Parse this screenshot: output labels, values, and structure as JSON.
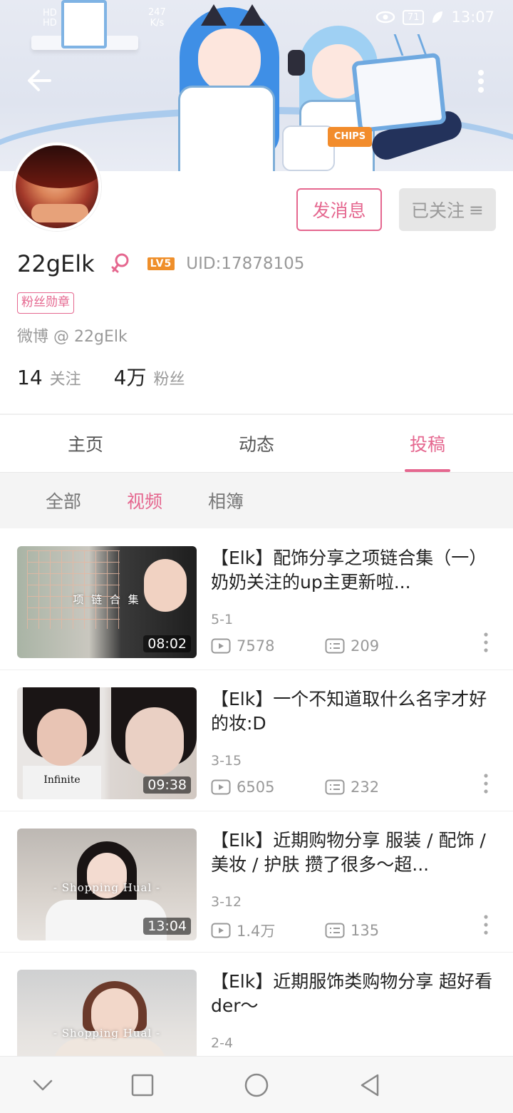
{
  "status": {
    "left_top": "HD",
    "left_bottom": "HD",
    "net_speed": "247",
    "net_unit": "K/s",
    "battery": "71",
    "time": "13:07"
  },
  "banner": {
    "chips_label": "CHIPS"
  },
  "profile": {
    "name": "22gElk",
    "level_badge": "LV5",
    "uid": "UID:17878105",
    "medal": "粉丝勋章",
    "weibo": "微博 @ 22gElk",
    "following_count": "14",
    "following_label": "关注",
    "fans_count": "4万",
    "fans_label": "粉丝"
  },
  "actions": {
    "message": "发消息",
    "followed": "已关注",
    "followed_icon": "≡"
  },
  "tabs": [
    {
      "label": "主页"
    },
    {
      "label": "动态"
    },
    {
      "label": "投稿"
    }
  ],
  "subtabs": [
    {
      "label": "全部"
    },
    {
      "label": "视频"
    },
    {
      "label": "相簿"
    }
  ],
  "videos": [
    {
      "title": "【Elk】配饰分享之项链合集（一）奶奶关注的up主更新啦...",
      "date": "5-1",
      "plays": "7578",
      "danmaku": "209",
      "duration": "08:02",
      "thumb_caption": "项 链 合 集"
    },
    {
      "title": "【Elk】一个不知道取什么名字才好的妆:D",
      "date": "3-15",
      "plays": "6505",
      "danmaku": "232",
      "duration": "09:38",
      "thumb_caption": "Infinite"
    },
    {
      "title": "【Elk】近期购物分享 服装 / 配饰 / 美妆 / 护肤 攒了很多～超...",
      "date": "3-12",
      "plays": "1.4万",
      "danmaku": "135",
      "duration": "13:04",
      "thumb_caption": "- Shopping Hual -"
    },
    {
      "title": "【Elk】近期服饰类购物分享 超好看der～",
      "date": "2-4",
      "plays": "",
      "danmaku": "",
      "duration": "",
      "thumb_caption": "- Shopping Hual -"
    }
  ],
  "colors": {
    "accent": "#e5678f",
    "muted": "#999999"
  },
  "icons": [
    "back-arrow-icon",
    "more-vertical-icon",
    "female-icon",
    "play-count-icon",
    "danmaku-icon",
    "item-more-icon",
    "nav-down-icon",
    "nav-square-icon",
    "nav-circle-icon",
    "nav-triangle-icon"
  ]
}
